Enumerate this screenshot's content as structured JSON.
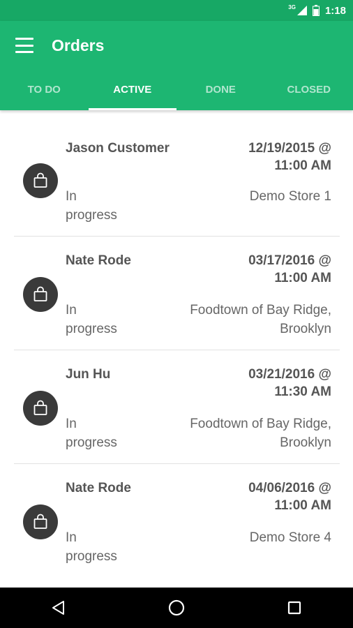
{
  "status_bar": {
    "network": "3G",
    "time": "1:18"
  },
  "app_bar": {
    "title": "Orders"
  },
  "tabs": [
    {
      "label": "TO DO",
      "active": false
    },
    {
      "label": "ACTIVE",
      "active": true
    },
    {
      "label": "DONE",
      "active": false
    },
    {
      "label": "CLOSED",
      "active": false
    }
  ],
  "orders": [
    {
      "customer": "Jason Customer",
      "date": "12/19/2015 @",
      "time": "11:00 AM",
      "status_line1": "In",
      "status_line2": "progress",
      "store_line1": "Demo Store 1",
      "store_line2": ""
    },
    {
      "customer": "Nate Rode",
      "date": "03/17/2016 @",
      "time": "11:00 AM",
      "status_line1": "In",
      "status_line2": "progress",
      "store_line1": "Foodtown of Bay Ridge,",
      "store_line2": "Brooklyn"
    },
    {
      "customer": "Jun Hu",
      "date": "03/21/2016 @",
      "time": "11:30 AM",
      "status_line1": "In",
      "status_line2": "progress",
      "store_line1": "Foodtown of Bay Ridge,",
      "store_line2": "Brooklyn"
    },
    {
      "customer": "Nate Rode",
      "date": "04/06/2016 @",
      "time": "11:00 AM",
      "status_line1": "In",
      "status_line2": "progress",
      "store_line1": "Demo Store 4",
      "store_line2": ""
    }
  ],
  "icons": {
    "menu": "menu-icon",
    "order": "shopping-bag-icon",
    "back": "back-icon",
    "home": "home-icon",
    "recents": "recents-icon"
  },
  "colors": {
    "primary": "#1db672",
    "primary_dark": "#17a865",
    "order_icon_bg": "#3a3a3a"
  }
}
